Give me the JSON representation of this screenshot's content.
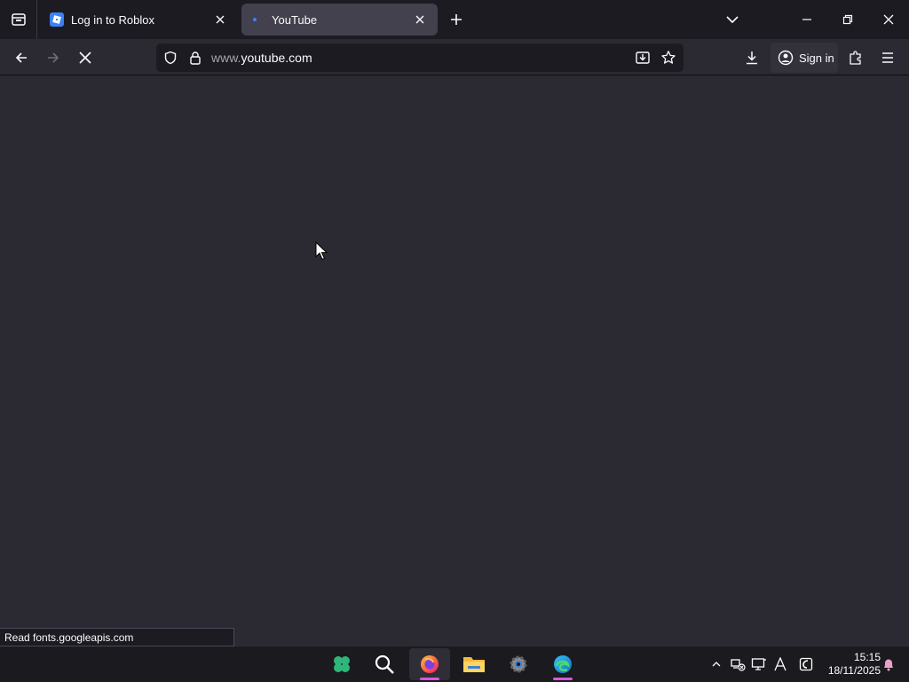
{
  "browser": {
    "tabs": [
      {
        "title": "Log in to Roblox",
        "active": false
      },
      {
        "title": "YouTube",
        "active": true,
        "loading": true
      }
    ],
    "url": {
      "prefix": "www.",
      "domain": "youtube.com"
    },
    "sign_in_label": "Sign in",
    "status_text": "Read fonts.googleapis.com"
  },
  "taskbar": {
    "apps": [
      "clover-app-icon",
      "search-icon",
      "firefox-icon",
      "file-explorer-icon",
      "settings-icon",
      "edge-icon"
    ],
    "clock": {
      "time": "15:15",
      "date": "18/11/2025"
    }
  },
  "colors": {
    "tabstrip": "#1c1b22",
    "toolbar": "#2b2a33",
    "active_tab": "#42414d",
    "accent_running": "#d657e2"
  }
}
